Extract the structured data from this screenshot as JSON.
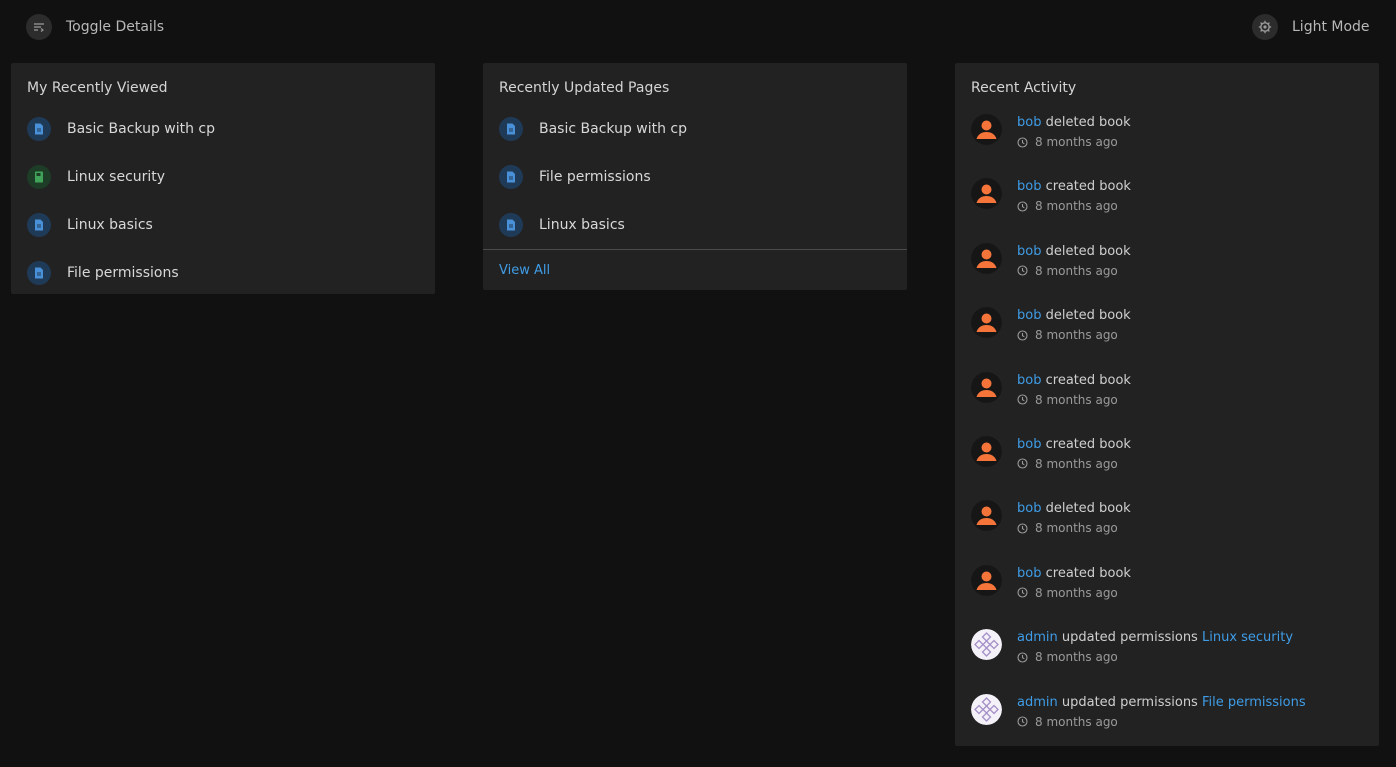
{
  "topbar": {
    "toggle_details_label": "Toggle Details",
    "toggle_details_icon": "toggle-details-icon",
    "light_mode_label": "Light Mode",
    "light_mode_icon": "gear-icon"
  },
  "recently_viewed": {
    "title": "My Recently Viewed",
    "items": [
      {
        "type": "page",
        "name": "Basic Backup with cp"
      },
      {
        "type": "book",
        "name": "Linux security"
      },
      {
        "type": "page",
        "name": "Linux basics"
      },
      {
        "type": "page",
        "name": "File permissions"
      }
    ]
  },
  "recently_updated": {
    "title": "Recently Updated Pages",
    "items": [
      {
        "type": "page",
        "name": "Basic Backup with cp"
      },
      {
        "type": "page",
        "name": "File permissions"
      },
      {
        "type": "page",
        "name": "Linux basics"
      }
    ],
    "view_all_label": "View All"
  },
  "recent_activity": {
    "title": "Recent Activity",
    "items": [
      {
        "user": "bob",
        "avatar": "bob",
        "action": "deleted book",
        "target": "",
        "time": "8 months ago"
      },
      {
        "user": "bob",
        "avatar": "bob",
        "action": "created book",
        "target": "",
        "time": "8 months ago"
      },
      {
        "user": "bob",
        "avatar": "bob",
        "action": "deleted book",
        "target": "",
        "time": "8 months ago"
      },
      {
        "user": "bob",
        "avatar": "bob",
        "action": "deleted book",
        "target": "",
        "time": "8 months ago"
      },
      {
        "user": "bob",
        "avatar": "bob",
        "action": "created book",
        "target": "",
        "time": "8 months ago"
      },
      {
        "user": "bob",
        "avatar": "bob",
        "action": "created book",
        "target": "",
        "time": "8 months ago"
      },
      {
        "user": "bob",
        "avatar": "bob",
        "action": "deleted book",
        "target": "",
        "time": "8 months ago"
      },
      {
        "user": "bob",
        "avatar": "bob",
        "action": "created book",
        "target": "",
        "time": "8 months ago"
      },
      {
        "user": "admin",
        "avatar": "admin",
        "action": "updated permissions",
        "target": "Linux security",
        "time": "8 months ago"
      },
      {
        "user": "admin",
        "avatar": "admin",
        "action": "updated permissions",
        "target": "File permissions",
        "time": "8 months ago"
      }
    ]
  },
  "colors": {
    "background": "#111111",
    "card": "#222222",
    "link": "#3f9ce6",
    "page_icon": "#4a90d9",
    "book_icon": "#3fa35a",
    "bob_avatar": "#f5743a"
  }
}
